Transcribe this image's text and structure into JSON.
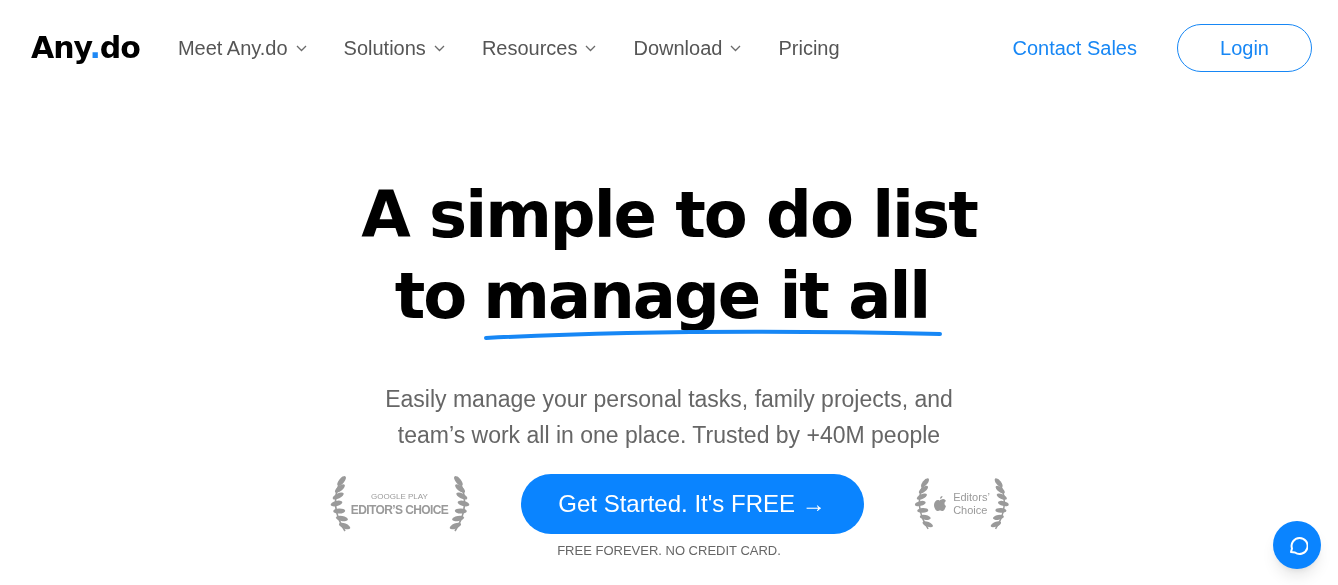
{
  "logo": {
    "before": "Any",
    "dot": ".",
    "after": "do"
  },
  "nav": [
    {
      "label": "Meet Any.do",
      "dropdown": true
    },
    {
      "label": "Solutions",
      "dropdown": true
    },
    {
      "label": "Resources",
      "dropdown": true
    },
    {
      "label": "Download",
      "dropdown": true
    },
    {
      "label": "Pricing",
      "dropdown": false
    }
  ],
  "contact_link": "Contact Sales",
  "login_button": "Login",
  "headline": {
    "line_1": "A simple to do list",
    "line_2_plain": "to",
    "line_2_underlined": "manage it all"
  },
  "subtitle": "Easily manage your personal tasks, family projects, and team’s work all in one place. Trusted by +40M people",
  "badge_left": {
    "top": "GOOGLE PLAY",
    "bottom": "EDITOR’S CHOICE"
  },
  "cta_button": "Get Started. It's FREE →",
  "badge_right": {
    "top": "Editors’",
    "bottom": "Choice"
  },
  "cta_note": "FREE FOREVER. NO CREDIT CARD."
}
